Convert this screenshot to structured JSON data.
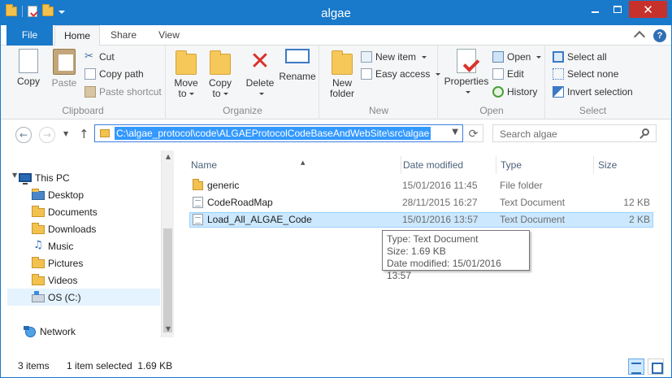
{
  "window": {
    "title": "algae"
  },
  "ribbon_tabs": [
    "File",
    "Home",
    "Share",
    "View"
  ],
  "ribbon": {
    "clipboard": {
      "label": "Clipboard",
      "copy": "Copy",
      "paste": "Paste",
      "cut": "Cut",
      "copy_path": "Copy path",
      "paste_shortcut": "Paste shortcut"
    },
    "organize": {
      "label": "Organize",
      "move_to_1": "Move",
      "move_to_2": "to",
      "copy_to_1": "Copy",
      "copy_to_2": "to",
      "delete": "Delete",
      "rename": "Rename"
    },
    "new": {
      "label": "New",
      "new_folder_1": "New",
      "new_folder_2": "folder",
      "new_item": "New item",
      "easy_access": "Easy access"
    },
    "open": {
      "label": "Open",
      "properties": "Properties",
      "open": "Open",
      "edit": "Edit",
      "history": "History"
    },
    "select": {
      "label": "Select",
      "select_all": "Select all",
      "select_none": "Select none",
      "invert_selection": "Invert selection"
    }
  },
  "address": {
    "path": "C:\\algae_protocol\\code\\ALGAEProtocolCodeBaseAndWebSite\\src\\algae",
    "search_placeholder": "Search algae"
  },
  "nav_pane": {
    "items": [
      {
        "label": "This PC",
        "icon": "computer-icon"
      },
      {
        "label": "Desktop",
        "icon": "folder-icon"
      },
      {
        "label": "Documents",
        "icon": "folder-icon"
      },
      {
        "label": "Downloads",
        "icon": "folder-icon"
      },
      {
        "label": "Music",
        "icon": "music-icon"
      },
      {
        "label": "Pictures",
        "icon": "folder-icon"
      },
      {
        "label": "Videos",
        "icon": "folder-icon"
      },
      {
        "label": "OS (C:)",
        "icon": "drive-icon"
      },
      {
        "label": "Network",
        "icon": "network-icon"
      }
    ]
  },
  "file_list": {
    "columns": [
      "Name",
      "Date modified",
      "Type",
      "Size"
    ],
    "rows": [
      {
        "name": "generic",
        "date": "15/01/2016 11:45",
        "type": "File folder",
        "size": ""
      },
      {
        "name": "CodeRoadMap",
        "date": "28/11/2015 16:27",
        "type": "Text Document",
        "size": "12 KB"
      },
      {
        "name": "Load_All_ALGAE_Code",
        "date": "15/01/2016 13:57",
        "type": "Text Document",
        "size": "2 KB"
      }
    ],
    "selected_index": 2
  },
  "tooltip": {
    "type": "Type: Text Document",
    "size": "Size: 1.69 KB",
    "date": "Date modified: 15/01/2016 13:57"
  },
  "status": {
    "items": "3 items",
    "selection": "1 item selected  1.69 KB"
  },
  "colors": {
    "accent": "#1979ca",
    "close_button": "#c7312b",
    "selection": "#cce8ff",
    "address_highlight": "#3399ff"
  }
}
